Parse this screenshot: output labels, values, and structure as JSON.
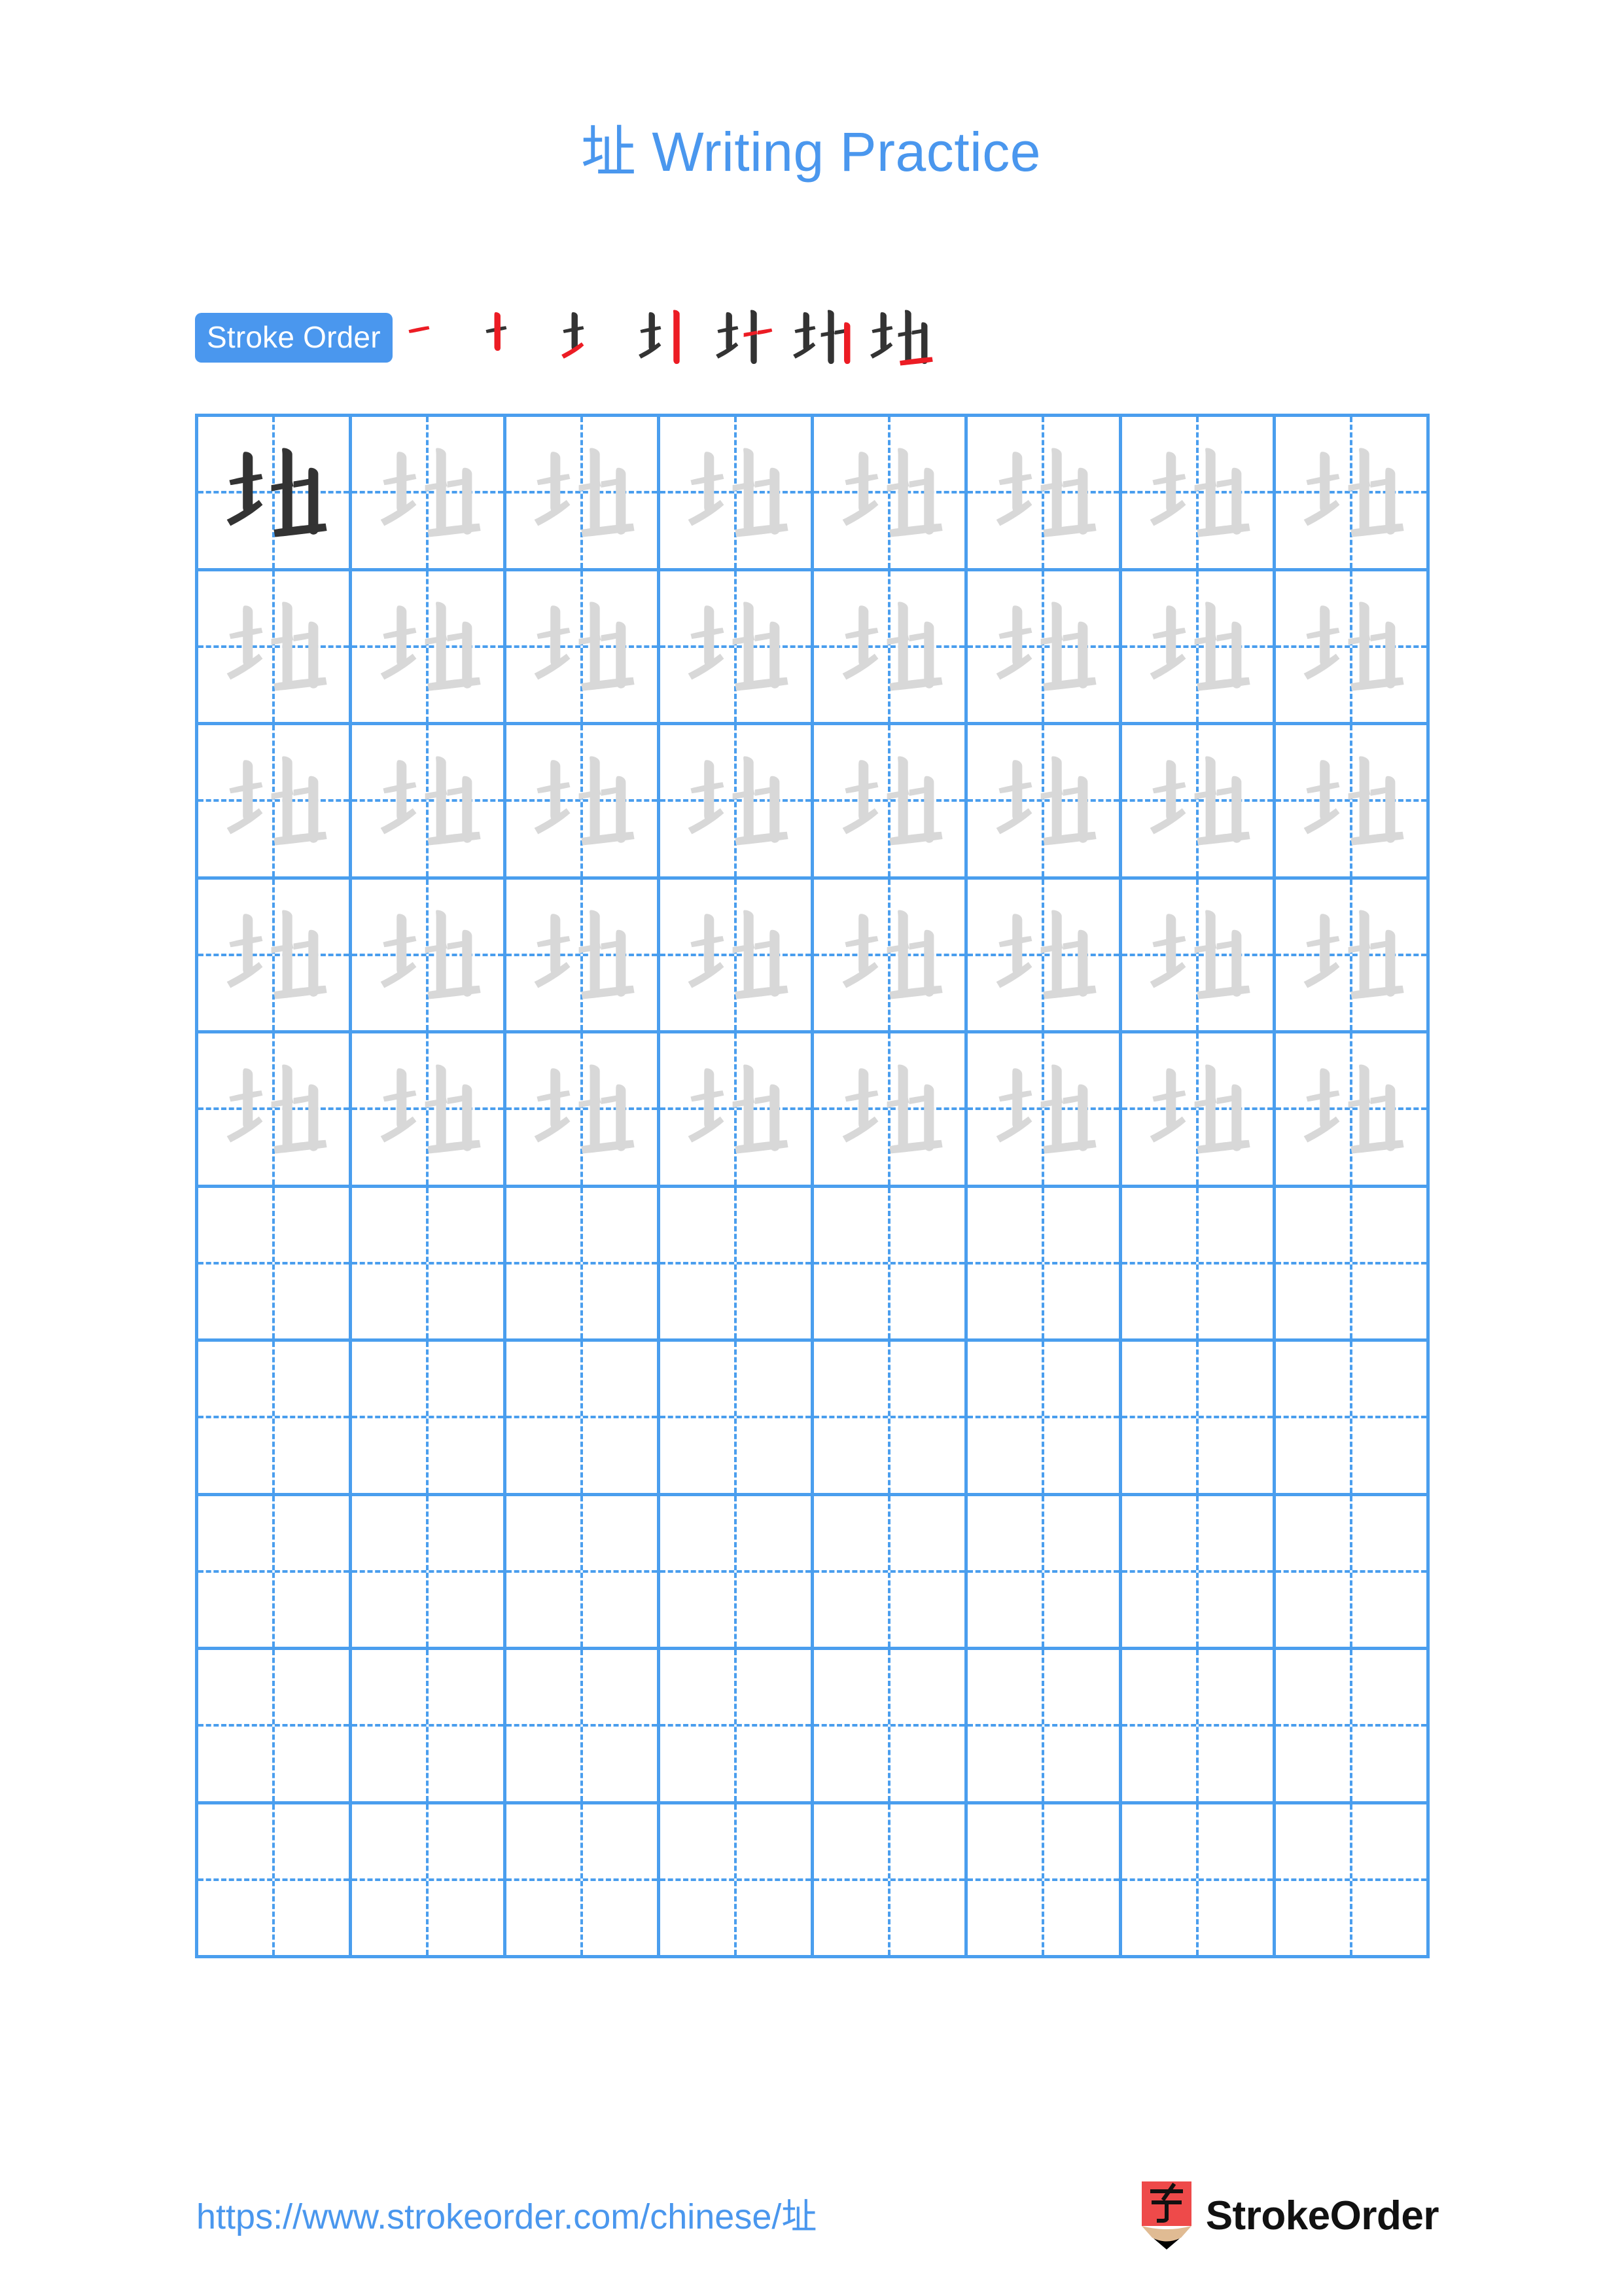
{
  "page": {
    "character": "址",
    "title_suffix": " Writing Practice",
    "title_full": "址 Writing Practice",
    "background_color": "#ffffff",
    "accent_color": "#4a97ee",
    "grid_line_color": "#4a9eee",
    "template_glyph_color": "#d8d8d8",
    "model_glyph_color": "#333333",
    "new_stroke_color": "#ec1c24"
  },
  "stroke_order": {
    "badge_label": "Stroke Order",
    "total_strokes": 7,
    "steps": [
      {
        "index": 1,
        "strokes_shown": 1,
        "new_stroke": 1
      },
      {
        "index": 2,
        "strokes_shown": 2,
        "new_stroke": 2
      },
      {
        "index": 3,
        "strokes_shown": 3,
        "new_stroke": 3
      },
      {
        "index": 4,
        "strokes_shown": 4,
        "new_stroke": 4
      },
      {
        "index": 5,
        "strokes_shown": 5,
        "new_stroke": 5
      },
      {
        "index": 6,
        "strokes_shown": 6,
        "new_stroke": 6
      },
      {
        "index": 7,
        "strokes_shown": 7,
        "new_stroke": 7
      }
    ]
  },
  "grid": {
    "columns": 8,
    "rows": 10,
    "filled_rows": 5,
    "empty_rows": 5,
    "model_cell": {
      "row": 1,
      "column": 1
    },
    "cells": [
      [
        "model",
        "trace",
        "trace",
        "trace",
        "trace",
        "trace",
        "trace",
        "trace"
      ],
      [
        "trace",
        "trace",
        "trace",
        "trace",
        "trace",
        "trace",
        "trace",
        "trace"
      ],
      [
        "trace",
        "trace",
        "trace",
        "trace",
        "trace",
        "trace",
        "trace",
        "trace"
      ],
      [
        "trace",
        "trace",
        "trace",
        "trace",
        "trace",
        "trace",
        "trace",
        "trace"
      ],
      [
        "trace",
        "trace",
        "trace",
        "trace",
        "trace",
        "trace",
        "trace",
        "trace"
      ],
      [
        "empty",
        "empty",
        "empty",
        "empty",
        "empty",
        "empty",
        "empty",
        "empty"
      ],
      [
        "empty",
        "empty",
        "empty",
        "empty",
        "empty",
        "empty",
        "empty",
        "empty"
      ],
      [
        "empty",
        "empty",
        "empty",
        "empty",
        "empty",
        "empty",
        "empty",
        "empty"
      ],
      [
        "empty",
        "empty",
        "empty",
        "empty",
        "empty",
        "empty",
        "empty",
        "empty"
      ],
      [
        "empty",
        "empty",
        "empty",
        "empty",
        "empty",
        "empty",
        "empty",
        "empty"
      ]
    ]
  },
  "footer": {
    "url": "https://www.strokeorder.com/chinese/址",
    "brand_name": "StrokeOrder",
    "logo_character": "字",
    "logo_body_color": "#ee4a4a",
    "logo_wood_color": "#e0bb93",
    "logo_tip_color": "#000000"
  }
}
